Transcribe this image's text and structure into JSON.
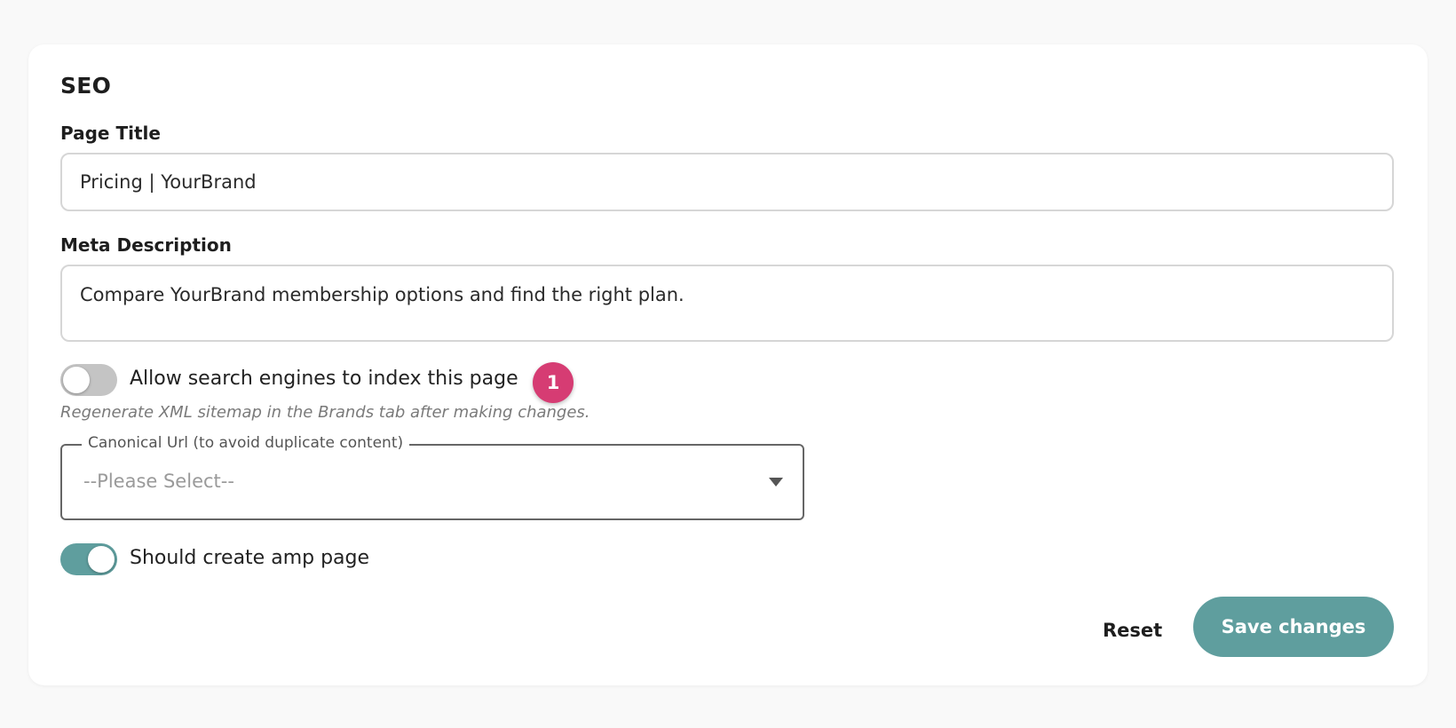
{
  "seo": {
    "section_title": "SEO",
    "page_title": {
      "label": "Page Title",
      "value": "Pricing | YourBrand"
    },
    "meta_description": {
      "label": "Meta Description",
      "value": "Compare YourBrand membership options and find the right plan."
    },
    "index_toggle": {
      "label": "Allow search engines to index this page",
      "checked": false,
      "badge": "1",
      "hint": "Regenerate XML sitemap in the Brands tab after making changes."
    },
    "canonical_url": {
      "legend": "Canonical Url (to avoid duplicate content)",
      "selected": "--Please Select--"
    },
    "amp_toggle": {
      "label": "Should create amp page",
      "checked": true
    },
    "actions": {
      "reset_label": "Reset",
      "save_label": "Save changes"
    }
  },
  "colors": {
    "accent": "#5f9e9e",
    "badge": "#d63c73",
    "toggle_off": "#c4c4c4",
    "background": "#f9f9f9",
    "card": "#ffffff"
  }
}
